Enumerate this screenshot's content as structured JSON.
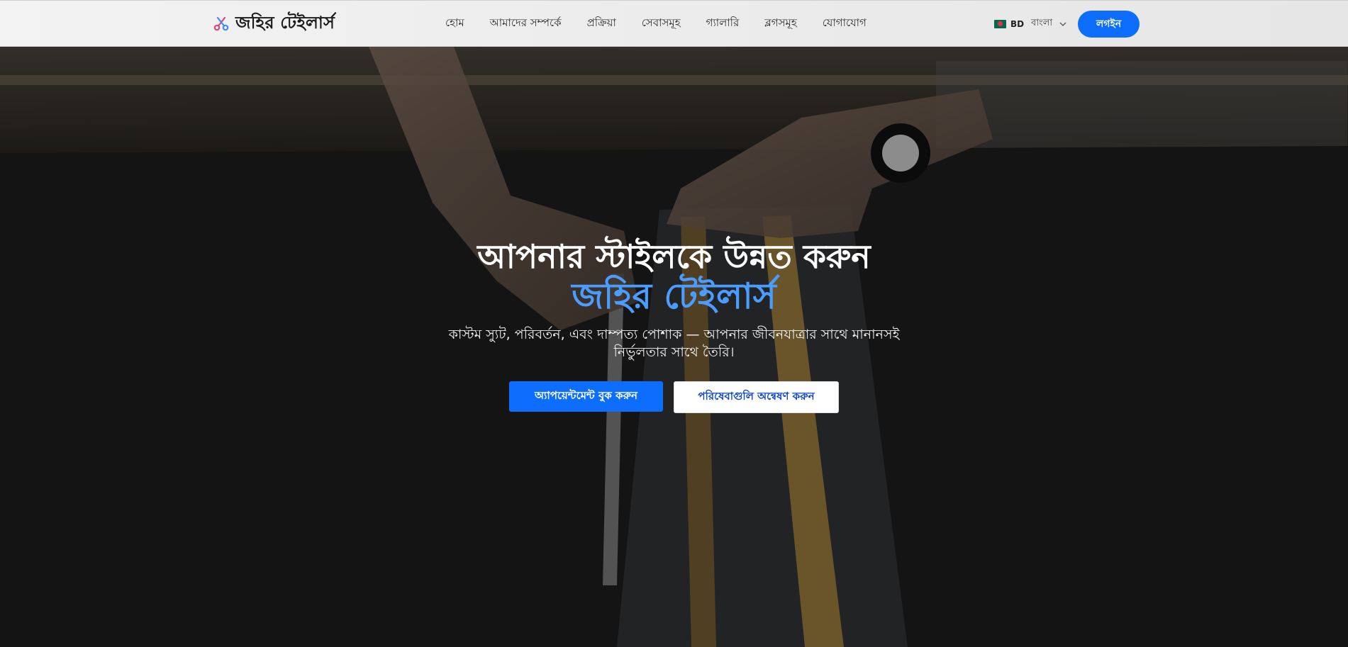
{
  "brand": {
    "name": "জহির টেইলার্স",
    "icon": "scissors-icon"
  },
  "nav": {
    "links": [
      "হোম",
      "আমাদের সম্পর্কে",
      "প্রক্রিয়া",
      "সেবাসমূহ",
      "গ্যালারি",
      "ব্লগসমূহ",
      "যোগাযোগ"
    ]
  },
  "language": {
    "flag": "bangladesh-flag-icon",
    "code": "BD",
    "name": "বাংলা"
  },
  "auth": {
    "login_label": "লগইন"
  },
  "hero": {
    "title": "আপনার স্টাইলকে উন্নত করুন",
    "title_accent": "জহির টেইলার্স",
    "subtitle": "কাস্টম স্যুট, পরিবর্তন, এবং দাম্পত্য পোশাক — আপনার জীবনযাত্রার সাথে মানানসই নির্ভুলতার সাথে তৈরি।",
    "primary_cta": "অ্যাপয়েন্টমেন্ট বুক করুন",
    "secondary_cta": "পরিষেবাগুলি অন্বেষণ করুন"
  },
  "colors": {
    "accent": "#0d6efd",
    "title_accent": "#4a9cff",
    "nav_bg": "#efefef"
  }
}
